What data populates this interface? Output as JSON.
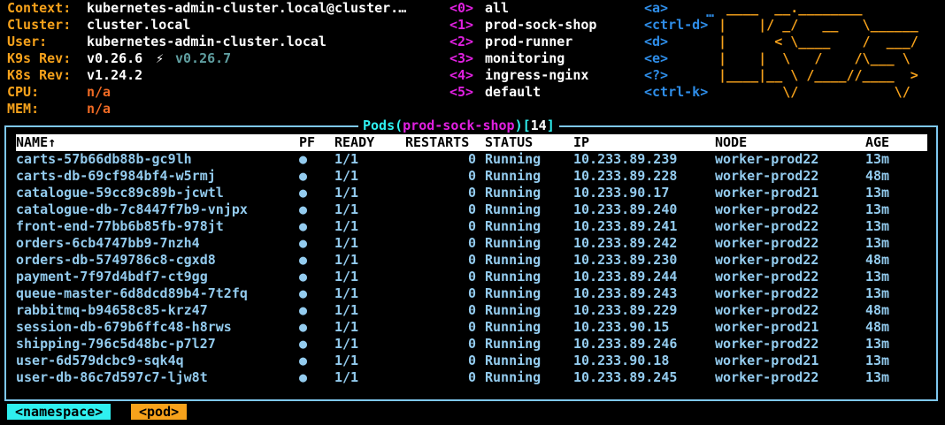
{
  "info": {
    "context_label": "Context:",
    "context_value": "kubernetes-admin-cluster.local@cluster.…",
    "cluster_label": "Cluster:",
    "cluster_value": "cluster.local",
    "user_label": "User:",
    "user_value": "kubernetes-admin-cluster.local",
    "k9s_rev_label": "K9s Rev:",
    "k9s_rev_value": "v0.26.6",
    "k9s_rev_upgrade_icon": "⚡",
    "k9s_rev_latest": "v0.26.7",
    "k8s_rev_label": "K8s Rev:",
    "k8s_rev_value": "v1.24.2",
    "cpu_label": "CPU:",
    "cpu_value": "n/a",
    "mem_label": "MEM:",
    "mem_value": "n/a"
  },
  "namespaces": [
    {
      "key": "<0>",
      "name": "all"
    },
    {
      "key": "<1>",
      "name": "prod-sock-shop"
    },
    {
      "key": "<2>",
      "name": "prod-runner"
    },
    {
      "key": "<3>",
      "name": "monitoring"
    },
    {
      "key": "<4>",
      "name": "ingress-nginx"
    },
    {
      "key": "<5>",
      "name": "default"
    }
  ],
  "hotkeys": [
    "<a>",
    "<ctrl-d>",
    "<d>",
    "<e>",
    "<?>",
    "<ctrl-k>"
  ],
  "hotkeys_more": "…",
  "logo_lines": [
    " ____  __.________       ",
    "|    |/ _/   __   \\______ ",
    "|      < \\____    /  ___/ ",
    "|    |  \\   /    /\\___ \\  ",
    "|____|__ \\ /____//____  > ",
    "        \\/            \\/  "
  ],
  "table": {
    "resource": "Pods",
    "namespace": "prod-sock-shop",
    "count": "14",
    "columns": {
      "name": "NAME↑",
      "pf": "PF",
      "ready": "READY",
      "restarts": "RESTARTS",
      "status": "STATUS",
      "ip": "IP",
      "node": "NODE",
      "age": "AGE"
    },
    "rows": [
      {
        "name": "carts-57b66db88b-gc9lh",
        "pf": "●",
        "ready": "1/1",
        "restarts": "0",
        "status": "Running",
        "ip": "10.233.89.239",
        "node": "worker-prod22",
        "age": "13m"
      },
      {
        "name": "carts-db-69cf984bf4-w5rmj",
        "pf": "●",
        "ready": "1/1",
        "restarts": "0",
        "status": "Running",
        "ip": "10.233.89.228",
        "node": "worker-prod22",
        "age": "48m"
      },
      {
        "name": "catalogue-59cc89c89b-jcwtl",
        "pf": "●",
        "ready": "1/1",
        "restarts": "0",
        "status": "Running",
        "ip": "10.233.90.17",
        "node": "worker-prod21",
        "age": "13m"
      },
      {
        "name": "catalogue-db-7c8447f7b9-vnjpx",
        "pf": "●",
        "ready": "1/1",
        "restarts": "0",
        "status": "Running",
        "ip": "10.233.89.240",
        "node": "worker-prod22",
        "age": "13m"
      },
      {
        "name": "front-end-77bb6b85fb-978jt",
        "pf": "●",
        "ready": "1/1",
        "restarts": "0",
        "status": "Running",
        "ip": "10.233.89.241",
        "node": "worker-prod22",
        "age": "13m"
      },
      {
        "name": "orders-6cb4747bb9-7nzh4",
        "pf": "●",
        "ready": "1/1",
        "restarts": "0",
        "status": "Running",
        "ip": "10.233.89.242",
        "node": "worker-prod22",
        "age": "13m"
      },
      {
        "name": "orders-db-5749786c8-cgxd8",
        "pf": "●",
        "ready": "1/1",
        "restarts": "0",
        "status": "Running",
        "ip": "10.233.89.230",
        "node": "worker-prod22",
        "age": "48m"
      },
      {
        "name": "payment-7f97d4bdf7-ct9gg",
        "pf": "●",
        "ready": "1/1",
        "restarts": "0",
        "status": "Running",
        "ip": "10.233.89.244",
        "node": "worker-prod22",
        "age": "13m"
      },
      {
        "name": "queue-master-6d8dcd89b4-7t2fq",
        "pf": "●",
        "ready": "1/1",
        "restarts": "0",
        "status": "Running",
        "ip": "10.233.89.243",
        "node": "worker-prod22",
        "age": "13m"
      },
      {
        "name": "rabbitmq-b94658c85-krz47",
        "pf": "●",
        "ready": "1/1",
        "restarts": "0",
        "status": "Running",
        "ip": "10.233.89.229",
        "node": "worker-prod22",
        "age": "48m"
      },
      {
        "name": "session-db-679b6ffc48-h8rws",
        "pf": "●",
        "ready": "1/1",
        "restarts": "0",
        "status": "Running",
        "ip": "10.233.90.15",
        "node": "worker-prod21",
        "age": "48m"
      },
      {
        "name": "shipping-796c5d48bc-p7l27",
        "pf": "●",
        "ready": "1/1",
        "restarts": "0",
        "status": "Running",
        "ip": "10.233.89.246",
        "node": "worker-prod22",
        "age": "13m"
      },
      {
        "name": "user-6d579dcbc9-sqk4q",
        "pf": "●",
        "ready": "1/1",
        "restarts": "0",
        "status": "Running",
        "ip": "10.233.90.18",
        "node": "worker-prod21",
        "age": "13m"
      },
      {
        "name": "user-db-86c7d597c7-ljw8t",
        "pf": "●",
        "ready": "1/1",
        "restarts": "0",
        "status": "Running",
        "ip": "10.233.89.245",
        "node": "worker-prod22",
        "age": "13m"
      }
    ]
  },
  "breadcrumbs": [
    {
      "label": "<namespace>",
      "color": "#2ff0f0"
    },
    {
      "label": "<pod>",
      "color": "#f7a21b"
    }
  ]
}
